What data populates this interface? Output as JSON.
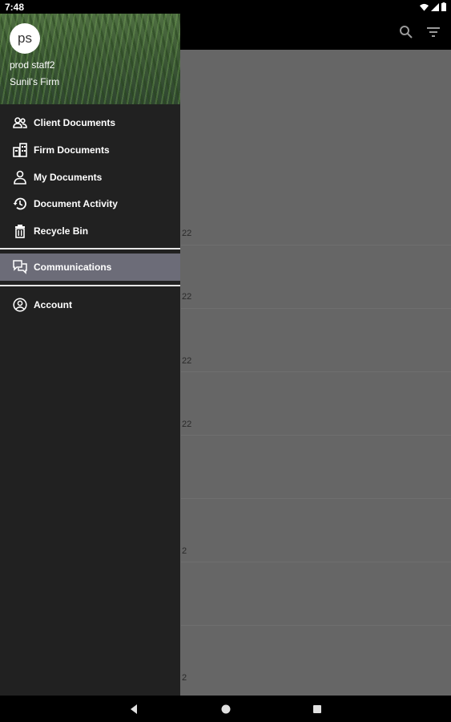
{
  "status": {
    "time": "7:48"
  },
  "drawer": {
    "avatar_initials": "ps",
    "user_name": "prod staff2",
    "firm_name": "Sunil's Firm",
    "items": [
      {
        "label": "Client Documents",
        "icon": "people-icon"
      },
      {
        "label": "Firm Documents",
        "icon": "building-icon"
      },
      {
        "label": "My Documents",
        "icon": "person-icon"
      },
      {
        "label": "Document Activity",
        "icon": "history-icon"
      },
      {
        "label": "Recycle Bin",
        "icon": "trash-icon"
      }
    ],
    "communications": {
      "label": "Communications",
      "icon": "chat-icon"
    },
    "account": {
      "label": "Account",
      "icon": "account-circle-icon"
    }
  },
  "main": {
    "dates": [
      "22",
      "22",
      "22",
      "22",
      "2",
      "2"
    ]
  },
  "colors": {
    "drawer_bg": "#212121",
    "selected_bg": "#6c6c78",
    "scrim": "#666666"
  }
}
